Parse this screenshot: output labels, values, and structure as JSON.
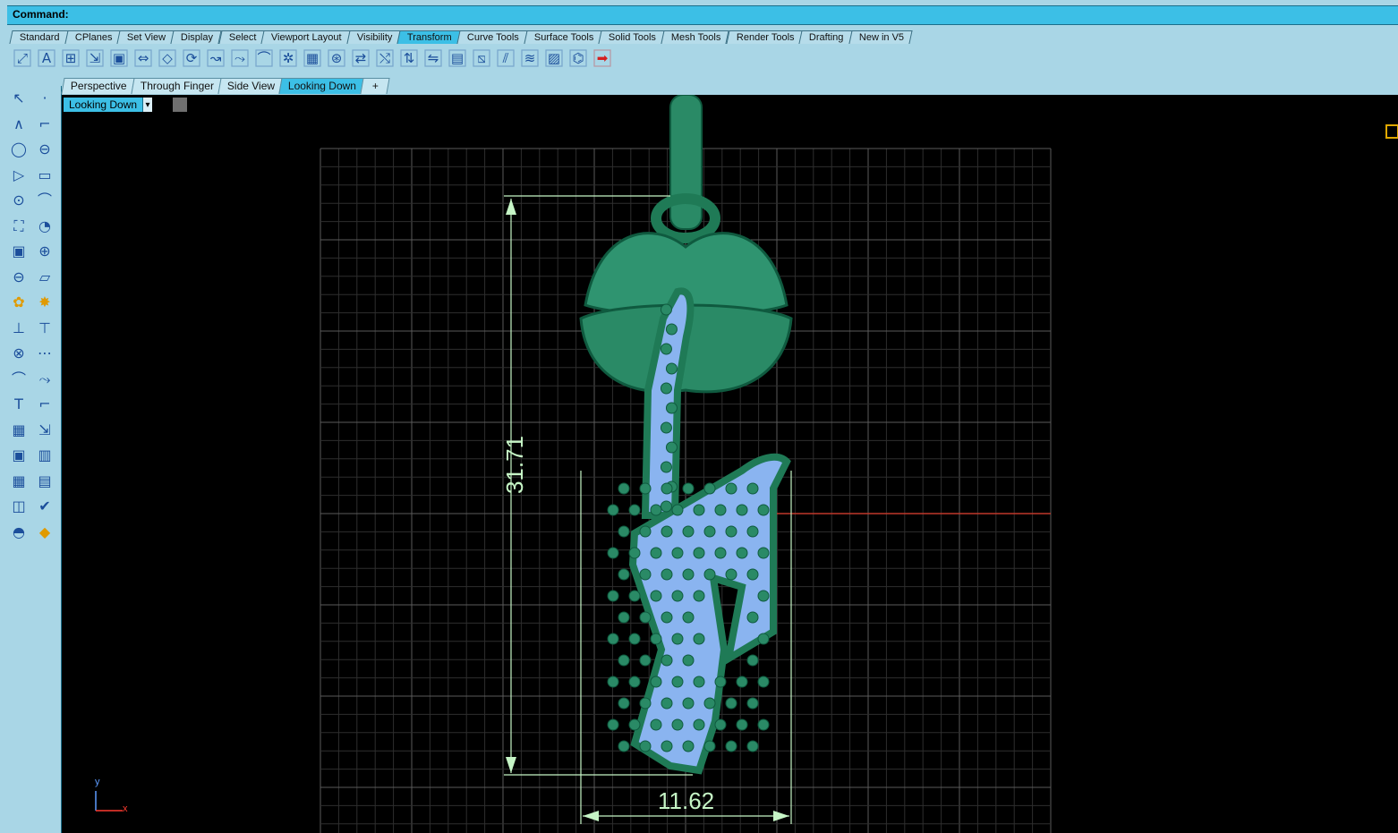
{
  "command": {
    "label": "Command:"
  },
  "tabs": [
    {
      "label": "Standard"
    },
    {
      "label": "CPlanes"
    },
    {
      "label": "Set View"
    },
    {
      "label": "Display"
    },
    {
      "label": "Select"
    },
    {
      "label": "Viewport Layout"
    },
    {
      "label": "Visibility"
    },
    {
      "label": "Transform",
      "active": true
    },
    {
      "label": "Curve Tools"
    },
    {
      "label": "Surface Tools"
    },
    {
      "label": "Solid Tools"
    },
    {
      "label": "Mesh Tools"
    },
    {
      "label": "Render Tools"
    },
    {
      "label": "Drafting"
    },
    {
      "label": "New in V5"
    }
  ],
  "toolbar_icons": [
    "move-icon",
    "align-icon",
    "array-icon",
    "scale-icon",
    "box-edit-icon",
    "mirror-icon",
    "orient-icon",
    "rotate-icon",
    "twist-icon",
    "flow-icon",
    "bend-icon",
    "polar-array-icon",
    "grid-array-icon",
    "smash-icon",
    "stretch-icon",
    "transform-ops-icon",
    "taper-icon",
    "splop-icon",
    "cage-edit-icon",
    "shear-icon",
    "flow-along-surface-icon",
    "maelstrom-icon",
    "orient-on-surface-icon",
    "set-pt-icon",
    "history-arrow-icon"
  ],
  "sidebar_icons": [
    "select-arrow-icon",
    "point-icon",
    "polyline-icon",
    "rectangle-curve-icon",
    "circle-icon",
    "ellipse-icon",
    "arc-icon",
    "rectangle-icon",
    "polygon-icon",
    "fillet-curve-icon",
    "surface-from-points-icon",
    "sweep-icon",
    "box-solid-icon",
    "boolean-union-icon",
    "cylinder-icon",
    "plane-icon",
    "gear-transform-icon",
    "explode-icon",
    "split-icon",
    "trim-icon",
    "group-icon",
    "ungroup-icon",
    "offset-curve-icon",
    "blend-curve-icon",
    "text-icon",
    "dimension-icon",
    "array-small-icon",
    "scale-small-icon",
    "box-edit-small-icon",
    "render-icon",
    "grid-array-small-icon",
    "stack-icon",
    "mesh-icon",
    "check-icon",
    "shaded-solids-icon",
    "paint-icon"
  ],
  "viewport_tabs": [
    {
      "label": "Perspective"
    },
    {
      "label": "Through Finger"
    },
    {
      "label": "Side View"
    },
    {
      "label": "Looking Down",
      "active": true
    },
    {
      "label": "+"
    }
  ],
  "viewport": {
    "label": "Looking Down",
    "dropdown_arrow": "▾"
  },
  "dimensions": {
    "vertical": "31.71",
    "horizontal": "11.62"
  },
  "axes": {
    "x": "x",
    "y": "y"
  },
  "colors": {
    "accent": "#3cbfe6",
    "panel": "#a9d6e6",
    "model": "#2a8a66",
    "stones": "#8ab4f0",
    "dim": "#c6f5c6"
  }
}
